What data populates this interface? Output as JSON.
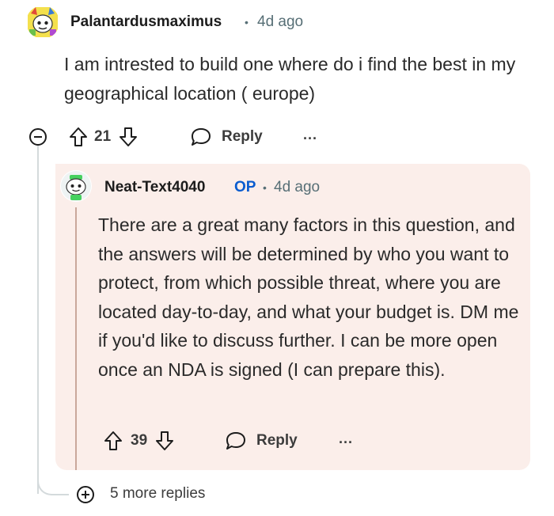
{
  "parent": {
    "username": "Palantardusmaximus",
    "age": "4d ago",
    "text": "I am intrested to build one where do i find the best in my geographical location ( europe)",
    "votes": "21",
    "reply_label": "Reply",
    "more_label": "···"
  },
  "reply": {
    "username": "Neat-Text4040",
    "op_badge": "OP",
    "age": "4d ago",
    "text": "There are a great many factors in this question, and the answers will be determined by who you want to protect, from which possible threat, where you are located day-to-day, and what your budget is. DM me if you'd like to discuss further. I can be more open once an NDA is signed (I can prepare this).",
    "votes": "39",
    "reply_label": "Reply",
    "more_label": "···"
  },
  "more_replies": {
    "label": "5 more replies"
  },
  "colors": {
    "op": "#0a5ccf",
    "reply_background": "#fbeeea",
    "thread_line": "#d4dadc",
    "meta": "#576f76"
  },
  "icons": {
    "collapse": "collapse-circle-minus-icon",
    "upvote": "upvote-arrow-icon",
    "downvote": "downvote-arrow-icon",
    "reply": "speech-bubble-icon",
    "more": "ellipsis-icon",
    "expand": "plus-circle-icon"
  }
}
